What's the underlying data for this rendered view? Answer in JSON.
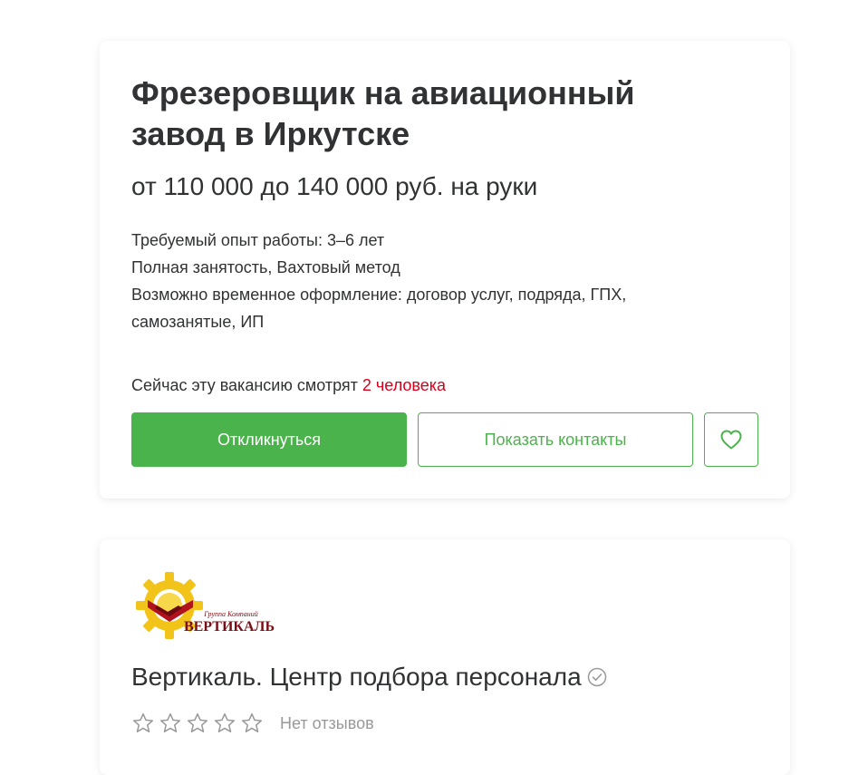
{
  "vacancy": {
    "title": "Фрезеровщик на авиационный завод в Иркутске",
    "salary": "от 110 000 до 140 000 руб. на руки",
    "experience": "Требуемый опыт работы: 3–6 лет",
    "employment": "Полная занятость, Вахтовый метод",
    "contract": "Возможно временное оформление: договор услуг, подряда, ГПХ, самозанятые, ИП",
    "viewers_prefix": "Сейчас эту вакансию смотрят",
    "viewers_count": "2 человека",
    "respond_label": "Откликнуться",
    "contacts_label": "Показать контакты",
    "favorite_icon": "heart-icon"
  },
  "company": {
    "logo_small_text": "Группа Компаний",
    "logo_big_text": "ВЕРТИКАЛЬ",
    "name": "Вертикаль. Центр подбора персонала",
    "verified_icon": "check-circle-icon",
    "rating_stars": 0,
    "reviews_label": "Нет отзывов"
  },
  "colors": {
    "accent_green": "#4bb34b",
    "viewers_red": "#d6001c",
    "text": "#303233",
    "muted": "#999999"
  }
}
